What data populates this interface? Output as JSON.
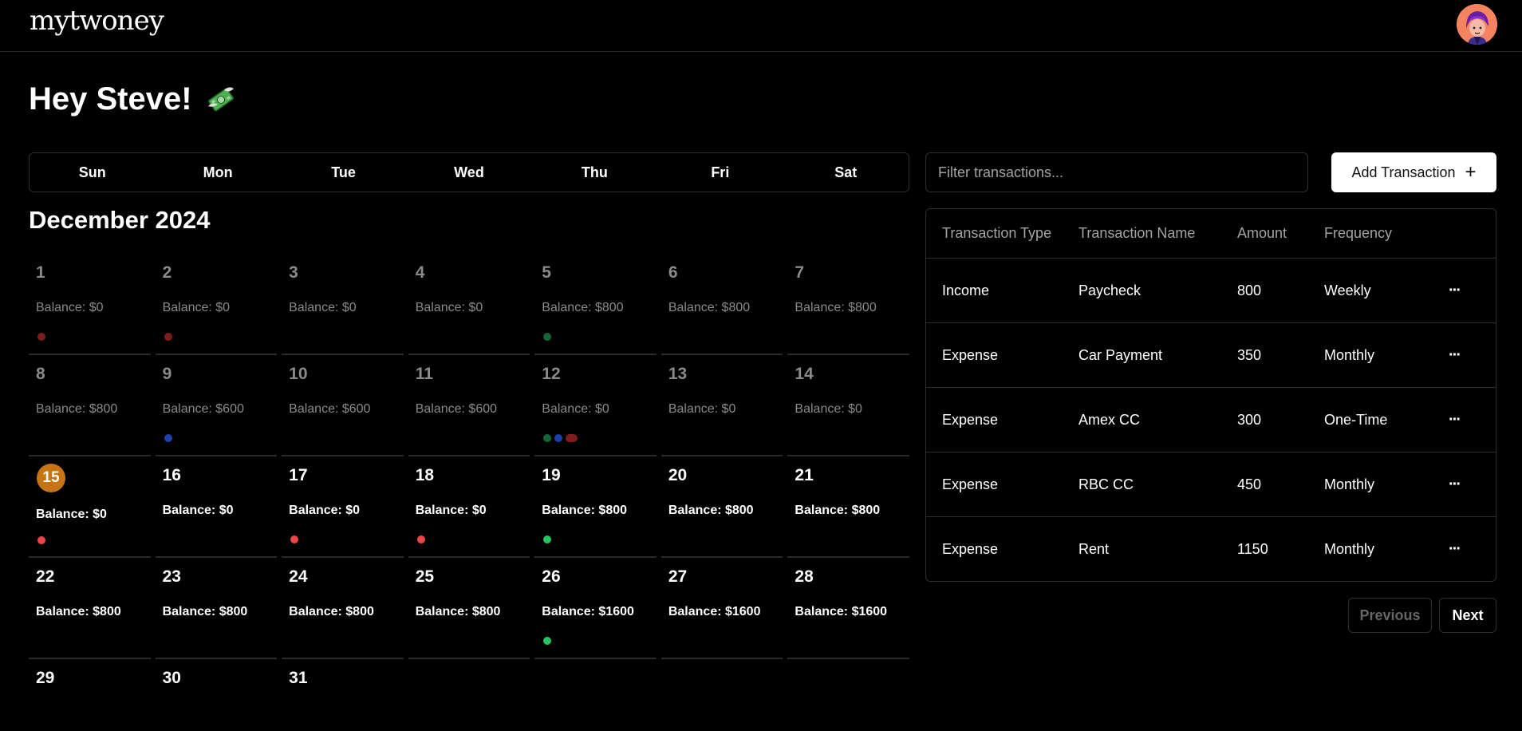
{
  "app": {
    "logo": "mytwoney"
  },
  "greeting": "Hey Steve!",
  "weekdays": [
    "Sun",
    "Mon",
    "Tue",
    "Wed",
    "Thu",
    "Fri",
    "Sat"
  ],
  "month_title": "December 2024",
  "colors": {
    "red_past": "#7f1d1d",
    "green_past": "#166534",
    "blue_past": "#1e40af",
    "red": "#ef4444",
    "green": "#22c55e",
    "today": "#c77414"
  },
  "days": [
    {
      "num": "1",
      "balance": "Balance: $0",
      "dots": [
        "red_past"
      ],
      "state": "past"
    },
    {
      "num": "2",
      "balance": "Balance: $0",
      "dots": [
        "red_past"
      ],
      "state": "past"
    },
    {
      "num": "3",
      "balance": "Balance: $0",
      "dots": [],
      "state": "past"
    },
    {
      "num": "4",
      "balance": "Balance: $0",
      "dots": [],
      "state": "past"
    },
    {
      "num": "5",
      "balance": "Balance: $800",
      "dots": [
        "green_past"
      ],
      "state": "past"
    },
    {
      "num": "6",
      "balance": "Balance: $800",
      "dots": [],
      "state": "past"
    },
    {
      "num": "7",
      "balance": "Balance: $800",
      "dots": [],
      "state": "past"
    },
    {
      "num": "8",
      "balance": "Balance: $800",
      "dots": [],
      "state": "past"
    },
    {
      "num": "9",
      "balance": "Balance: $600",
      "dots": [
        "blue_past"
      ],
      "state": "past"
    },
    {
      "num": "10",
      "balance": "Balance: $600",
      "dots": [],
      "state": "past"
    },
    {
      "num": "11",
      "balance": "Balance: $600",
      "dots": [],
      "state": "past"
    },
    {
      "num": "12",
      "balance": "Balance: $0",
      "dots": [
        "green_past",
        "blue_past",
        "red_past_pill"
      ],
      "state": "past"
    },
    {
      "num": "13",
      "balance": "Balance: $0",
      "dots": [],
      "state": "past"
    },
    {
      "num": "14",
      "balance": "Balance: $0",
      "dots": [],
      "state": "past"
    },
    {
      "num": "15",
      "balance": "Balance: $0",
      "dots": [
        "red"
      ],
      "state": "today"
    },
    {
      "num": "16",
      "balance": "Balance: $0",
      "dots": [],
      "state": "future"
    },
    {
      "num": "17",
      "balance": "Balance: $0",
      "dots": [
        "red"
      ],
      "state": "future"
    },
    {
      "num": "18",
      "balance": "Balance: $0",
      "dots": [
        "red"
      ],
      "state": "future"
    },
    {
      "num": "19",
      "balance": "Balance: $800",
      "dots": [
        "green"
      ],
      "state": "future"
    },
    {
      "num": "20",
      "balance": "Balance: $800",
      "dots": [],
      "state": "future"
    },
    {
      "num": "21",
      "balance": "Balance: $800",
      "dots": [],
      "state": "future"
    },
    {
      "num": "22",
      "balance": "Balance: $800",
      "dots": [],
      "state": "future"
    },
    {
      "num": "23",
      "balance": "Balance: $800",
      "dots": [],
      "state": "future"
    },
    {
      "num": "24",
      "balance": "Balance: $800",
      "dots": [],
      "state": "future"
    },
    {
      "num": "25",
      "balance": "Balance: $800",
      "dots": [],
      "state": "future"
    },
    {
      "num": "26",
      "balance": "Balance: $1600",
      "dots": [
        "green"
      ],
      "state": "future"
    },
    {
      "num": "27",
      "balance": "Balance: $1600",
      "dots": [],
      "state": "future"
    },
    {
      "num": "28",
      "balance": "Balance: $1600",
      "dots": [],
      "state": "future"
    },
    {
      "num": "29",
      "balance": "",
      "dots": [],
      "state": "future"
    },
    {
      "num": "30",
      "balance": "",
      "dots": [],
      "state": "future"
    },
    {
      "num": "31",
      "balance": "",
      "dots": [],
      "state": "future"
    }
  ],
  "filter": {
    "placeholder": "Filter transactions..."
  },
  "add_button": {
    "label": "Add Transaction",
    "icon": "plus-icon"
  },
  "table": {
    "headers": [
      "Transaction Type",
      "Transaction Name",
      "Amount",
      "Frequency"
    ],
    "rows": [
      {
        "type": "Income",
        "name": "Paycheck",
        "amount": "800",
        "frequency": "Weekly"
      },
      {
        "type": "Expense",
        "name": "Car Payment",
        "amount": "350",
        "frequency": "Monthly"
      },
      {
        "type": "Expense",
        "name": "Amex CC",
        "amount": "300",
        "frequency": "One-Time"
      },
      {
        "type": "Expense",
        "name": "RBC CC",
        "amount": "450",
        "frequency": "Monthly"
      },
      {
        "type": "Expense",
        "name": "Rent",
        "amount": "1150",
        "frequency": "Monthly"
      }
    ],
    "row_menu_label": "···"
  },
  "pagination": {
    "previous": "Previous",
    "next": "Next"
  }
}
